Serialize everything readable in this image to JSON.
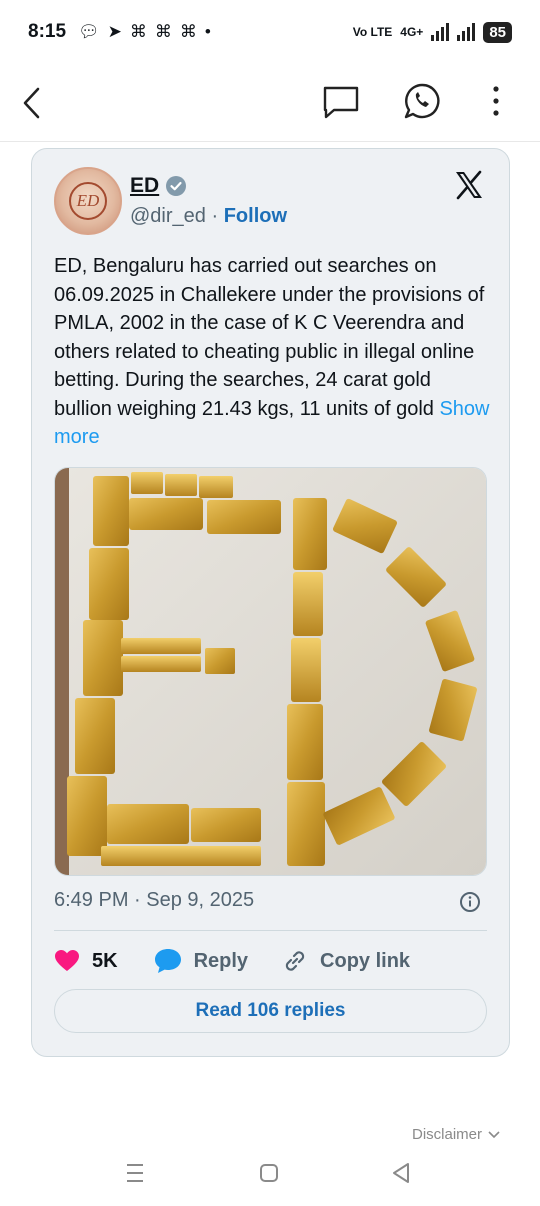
{
  "status_bar": {
    "time": "8:15",
    "notification_icons": [
      "chat-icon",
      "telegram-icon",
      "app-icon",
      "app-icon",
      "app-icon",
      "dot-icon"
    ],
    "network_label": "Vo LTE",
    "network_type": "4G+",
    "battery": "85"
  },
  "app_bar": {
    "icons": [
      "back-arrow-icon",
      "comment-icon",
      "whatsapp-icon",
      "more-vertical-icon"
    ]
  },
  "tweet": {
    "author_name": "ED",
    "handle": "@dir_ed",
    "separator": "·",
    "follow_label": "Follow",
    "text": "ED, Bengaluru has carried out searches on 06.09.2025 in Challekere under the provisions of PMLA, 2002 in the case of K C Veerendra and others related to cheating public in illegal online betting. During the searches, 24 carat gold bullion weighing 21.43 kgs, 11 units of gold",
    "show_more": "Show more",
    "timestamp": "6:49 PM · Sep 9, 2025",
    "like_count": "5K",
    "reply_label": "Reply",
    "copy_link_label": "Copy link",
    "read_replies_label": "Read 106 replies",
    "colors": {
      "accent": "#1d9bf0",
      "like": "#f91880",
      "follow": "#1d6fb8"
    }
  },
  "footer": {
    "disclaimer": "Disclaimer"
  }
}
